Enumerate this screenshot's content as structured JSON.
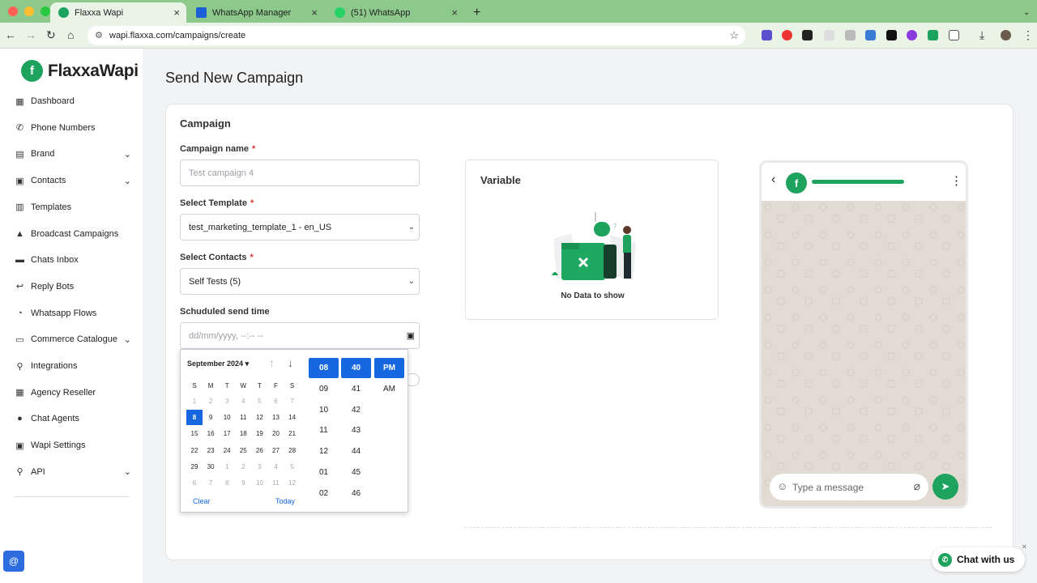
{
  "browser": {
    "tabs": [
      {
        "label": "Flaxxa Wapi",
        "active": true
      },
      {
        "label": "WhatsApp Manager",
        "active": false
      },
      {
        "label": "(51) WhatsApp",
        "active": false
      }
    ],
    "url": "wapi.flaxxa.com/campaigns/create"
  },
  "sidebar": {
    "logo": "FlaxxaWapi",
    "logo_mark": "f",
    "items": [
      {
        "label": "Dashboard",
        "icon": "dashboard-icon"
      },
      {
        "label": "Phone Numbers",
        "icon": "phone-icon"
      },
      {
        "label": "Brand",
        "icon": "brand-icon",
        "has_chevron": true
      },
      {
        "label": "Contacts",
        "icon": "contacts-icon",
        "has_chevron": true
      },
      {
        "label": "Templates",
        "icon": "templates-icon"
      },
      {
        "label": "Broadcast Campaigns",
        "icon": "broadcast-icon"
      },
      {
        "label": "Chats Inbox",
        "icon": "chat-icon"
      },
      {
        "label": "Reply Bots",
        "icon": "bot-icon"
      },
      {
        "label": "Whatsapp Flows",
        "icon": "flows-icon"
      },
      {
        "label": "Commerce Catalogue",
        "icon": "catalogue-icon",
        "has_chevron": true
      },
      {
        "label": "Integrations",
        "icon": "integrations-icon"
      },
      {
        "label": "Agency Reseller",
        "icon": "reseller-icon"
      },
      {
        "label": "Chat Agents",
        "icon": "agent-icon"
      },
      {
        "label": "Wapi Settings",
        "icon": "settings-icon"
      },
      {
        "label": "API",
        "icon": "api-icon",
        "has_chevron": true
      }
    ]
  },
  "page": {
    "title": "Send New Campaign",
    "section_title": "Campaign",
    "campaign_name": {
      "label": "Campaign name",
      "placeholder": "Test campaign 4"
    },
    "template": {
      "label": "Select Template",
      "value": "test_marketing_template_1 - en_US"
    },
    "contacts": {
      "label": "Select Contacts",
      "value": "Self Tests (5)"
    },
    "send_time": {
      "label": "Schuduled send time",
      "placeholder": "dd/mm/yyyy, --:-- --"
    },
    "variable": {
      "title": "Variable",
      "empty_text": "No Data to show"
    },
    "preview": {
      "composer_placeholder": "Type a message"
    }
  },
  "datepicker": {
    "month_label": "September 2024",
    "weekdays": [
      "S",
      "M",
      "T",
      "W",
      "T",
      "F",
      "S"
    ],
    "weeks": [
      [
        {
          "d": "1",
          "dim": true
        },
        {
          "d": "2",
          "dim": true
        },
        {
          "d": "3",
          "dim": true
        },
        {
          "d": "4",
          "dim": true
        },
        {
          "d": "5",
          "dim": true
        },
        {
          "d": "6",
          "dim": true
        },
        {
          "d": "7",
          "dim": true
        }
      ],
      [
        {
          "d": "8",
          "sel": true
        },
        {
          "d": "9"
        },
        {
          "d": "10"
        },
        {
          "d": "11"
        },
        {
          "d": "12"
        },
        {
          "d": "13"
        },
        {
          "d": "14"
        }
      ],
      [
        {
          "d": "15"
        },
        {
          "d": "16"
        },
        {
          "d": "17"
        },
        {
          "d": "18"
        },
        {
          "d": "19"
        },
        {
          "d": "20"
        },
        {
          "d": "21"
        }
      ],
      [
        {
          "d": "22"
        },
        {
          "d": "23"
        },
        {
          "d": "24"
        },
        {
          "d": "25"
        },
        {
          "d": "26"
        },
        {
          "d": "27"
        },
        {
          "d": "28"
        }
      ],
      [
        {
          "d": "29"
        },
        {
          "d": "30"
        },
        {
          "d": "1",
          "dim": true
        },
        {
          "d": "2",
          "dim": true
        },
        {
          "d": "3",
          "dim": true
        },
        {
          "d": "4",
          "dim": true
        },
        {
          "d": "5",
          "dim": true
        }
      ],
      [
        {
          "d": "6",
          "dim": true
        },
        {
          "d": "7",
          "dim": true
        },
        {
          "d": "8",
          "dim": true
        },
        {
          "d": "9",
          "dim": true
        },
        {
          "d": "10",
          "dim": true
        },
        {
          "d": "11",
          "dim": true
        },
        {
          "d": "12",
          "dim": true
        }
      ]
    ],
    "clear_label": "Clear",
    "today_label": "Today",
    "hours": [
      "08",
      "09",
      "10",
      "11",
      "12",
      "01",
      "02"
    ],
    "minutes": [
      "40",
      "41",
      "42",
      "43",
      "44",
      "45",
      "46"
    ],
    "ampm": [
      "PM",
      "AM"
    ],
    "selected": {
      "hour": "08",
      "minute": "40",
      "ampm": "PM"
    }
  },
  "chat_widget": {
    "label": "Chat with us"
  },
  "fab": {
    "label": "@"
  },
  "colors": {
    "accent": "#1767e0",
    "brand_green": "#1ea35f",
    "chrome_green": "#8cc98a"
  }
}
